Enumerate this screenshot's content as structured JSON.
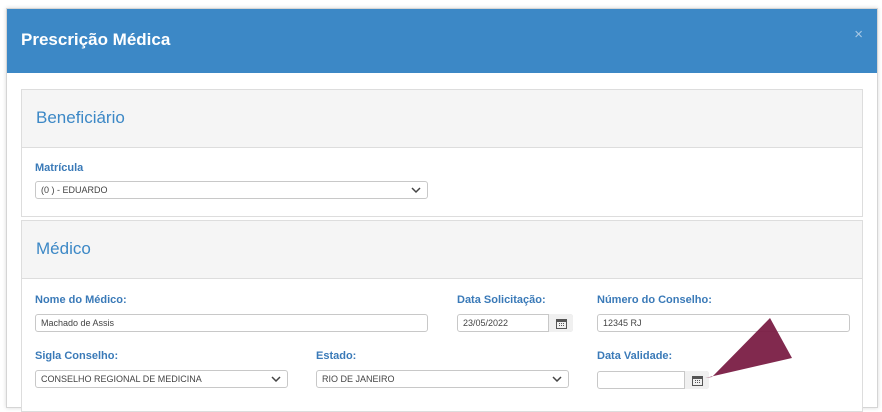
{
  "modal": {
    "title": "Prescrição Médica",
    "close": "×"
  },
  "beneficiario": {
    "title": "Beneficiário",
    "matricula_label": "Matrícula",
    "matricula_value": "(0          ) - EDUARDO"
  },
  "medico": {
    "title": "Médico",
    "nome_label": "Nome do Médico:",
    "nome_value": "Machado de Assis",
    "data_solicitacao_label": "Data Solicitação:",
    "data_solicitacao_value": "23/05/2022",
    "numero_conselho_label": "Número do Conselho:",
    "numero_conselho_value": "12345 RJ",
    "sigla_label": "Sigla Conselho:",
    "sigla_value": "CONSELHO REGIONAL DE MEDICINA",
    "estado_label": "Estado:",
    "estado_value": "RIO DE JANEIRO",
    "data_validade_label": "Data Validade:",
    "data_validade_value": ""
  },
  "colors": {
    "header": "#3c88c6",
    "label": "#3a7ab8",
    "arrow": "#7a1e45"
  }
}
